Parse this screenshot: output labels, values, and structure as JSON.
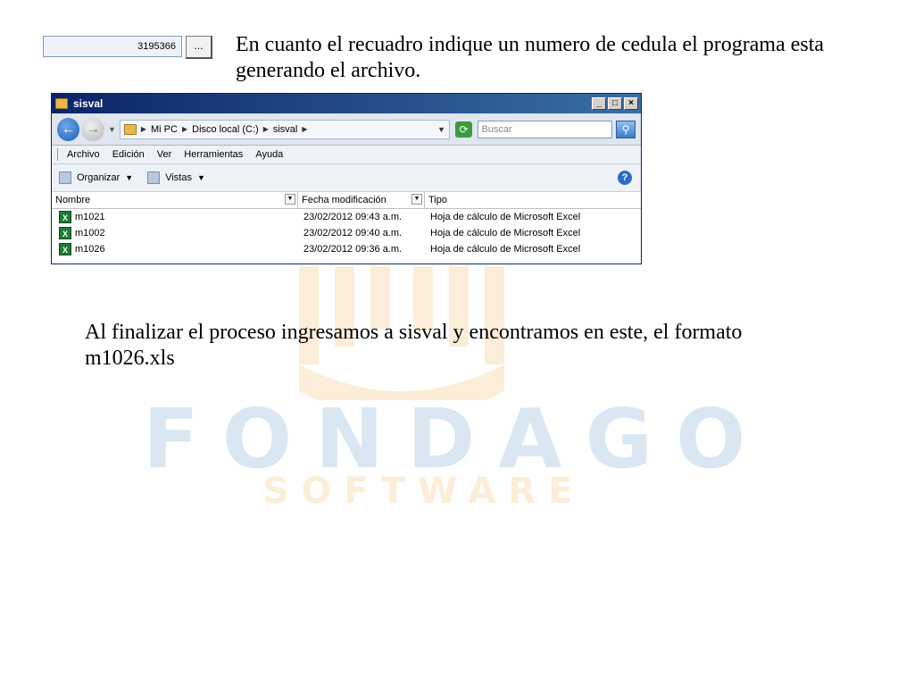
{
  "top_field": {
    "value": "3195366",
    "button_label": "..."
  },
  "captions": {
    "top": "En cuanto el recuadro indique un numero de cedula el programa esta generando el archivo.",
    "bottom": "Al finalizar el proceso ingresamos a sisval y encontramos en este, el formato m1026.xls"
  },
  "watermark": {
    "word1": "FONDAGO",
    "word2": "SOFTWARE"
  },
  "window": {
    "title": "sisval",
    "controls": {
      "minimize": "_",
      "maximize": "□",
      "close": "×"
    },
    "breadcrumb": [
      "Mi PC",
      "Disco local (C:)",
      "sisval"
    ],
    "search_placeholder": "Buscar",
    "menu": [
      "Archivo",
      "Edición",
      "Ver",
      "Herramientas",
      "Ayuda"
    ],
    "toolbar": {
      "organize": "Organizar",
      "views": "Vistas"
    },
    "columns": {
      "name": "Nombre",
      "date": "Fecha modificación",
      "type": "Tipo"
    },
    "files": [
      {
        "name": "m1021",
        "date": "23/02/2012 09:43 a.m.",
        "type": "Hoja de cálculo de Microsoft Excel"
      },
      {
        "name": "m1002",
        "date": "23/02/2012 09:40 a.m.",
        "type": "Hoja de cálculo de Microsoft Excel"
      },
      {
        "name": "m1026",
        "date": "23/02/2012 09:36 a.m.",
        "type": "Hoja de cálculo de Microsoft Excel"
      }
    ]
  }
}
